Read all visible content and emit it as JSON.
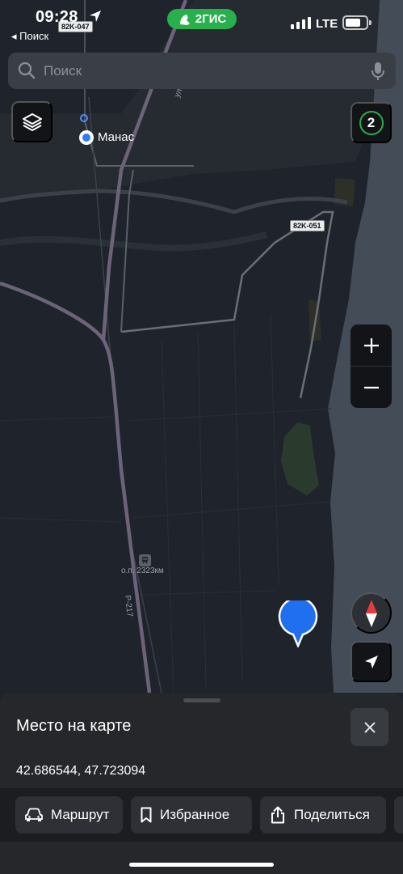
{
  "status_bar": {
    "time": "09:28",
    "back_label": "◂ Поиск",
    "app_badge": "2ГИС",
    "network": "LTE"
  },
  "search": {
    "placeholder": "Поиск"
  },
  "map": {
    "traffic_level": "2",
    "place_label": "Манас",
    "road_shields": [
      "82K-047",
      "82K-051"
    ],
    "stop_label": "о.п. 2323км",
    "road_label": "Р-217",
    "street_label": "ул. Буйн",
    "colors": {
      "land": "#1f242c",
      "sea": "#434c57",
      "road_major": "#6c6379",
      "road_minor": "#5b6068",
      "green": "#2a3b2e",
      "accent_green": "#27b04b",
      "pin_blue": "#1f6ff0"
    }
  },
  "sheet": {
    "title": "Место на карте",
    "coordinates": "42.686544, 47.723094",
    "actions": {
      "route": "Маршрут",
      "favorites": "Избранное",
      "share": "Поделиться"
    }
  }
}
